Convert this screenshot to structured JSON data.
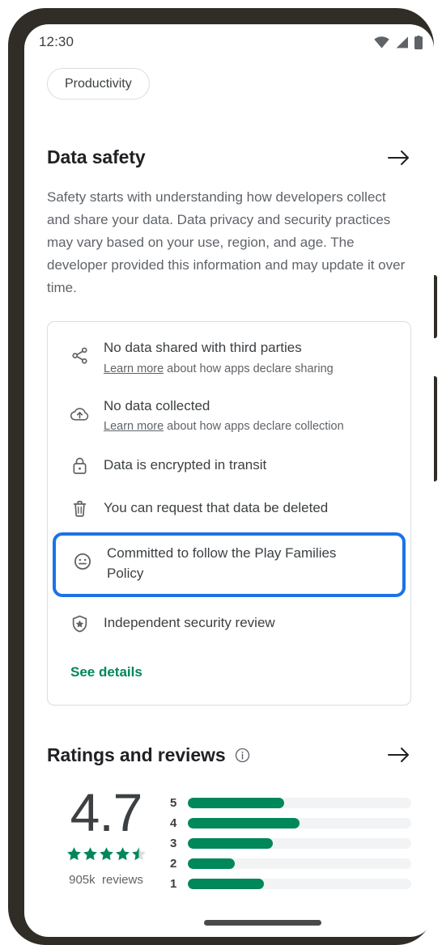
{
  "status_bar": {
    "time": "12:30",
    "icons": [
      "wifi-icon",
      "signal-icon",
      "battery-icon"
    ]
  },
  "chip": {
    "label": "Productivity"
  },
  "data_safety": {
    "title": "Data safety",
    "arrow_icon": "arrow-right-icon",
    "description": "Safety starts with understanding how developers collect and share your data. Data privacy and security practices may vary based on your use, region, and age. The developer provided this information and may update it over time.",
    "rows": [
      {
        "icon": "share-icon",
        "title": "No data shared with third parties",
        "link_text": "Learn more",
        "sub_rest": " about how apps declare sharing"
      },
      {
        "icon": "cloud-upload-icon",
        "title": "No data collected",
        "link_text": "Learn more",
        "sub_rest": " about how apps declare collection"
      },
      {
        "icon": "lock-icon",
        "title": "Data is encrypted in transit"
      },
      {
        "icon": "trash-icon",
        "title": "You can request that data be deleted"
      },
      {
        "icon": "smiley-face-icon",
        "title": "Committed to follow the Play Families Policy",
        "highlighted": true,
        "highlight_color": "#1a73e8"
      },
      {
        "icon": "shield-star-icon",
        "title": "Independent security review"
      }
    ],
    "see_details_label": "See details",
    "see_details_color": "#00875a"
  },
  "ratings": {
    "title": "Ratings and reviews",
    "info_icon": "info-icon",
    "arrow_icon": "arrow-right-icon",
    "score": "4.7",
    "stars_filled": 4.5,
    "stars_total": 5,
    "star_color": "#00875a",
    "review_count": "905k",
    "review_count_label": "reviews"
  },
  "chart_data": {
    "type": "bar",
    "orientation": "horizontal",
    "title": "Ratings and reviews",
    "categories": [
      "5",
      "4",
      "3",
      "2",
      "1"
    ],
    "values": [
      43,
      50,
      38,
      21,
      34
    ],
    "value_unit": "percent of track width",
    "xlabel": "",
    "ylabel": "",
    "xlim": [
      0,
      100
    ],
    "grid": false,
    "legend": false,
    "bar_color": "#00875a",
    "track_color": "#f1f3f4",
    "annotations": {
      "score": "4.7",
      "review_count": "905k reviews"
    }
  }
}
